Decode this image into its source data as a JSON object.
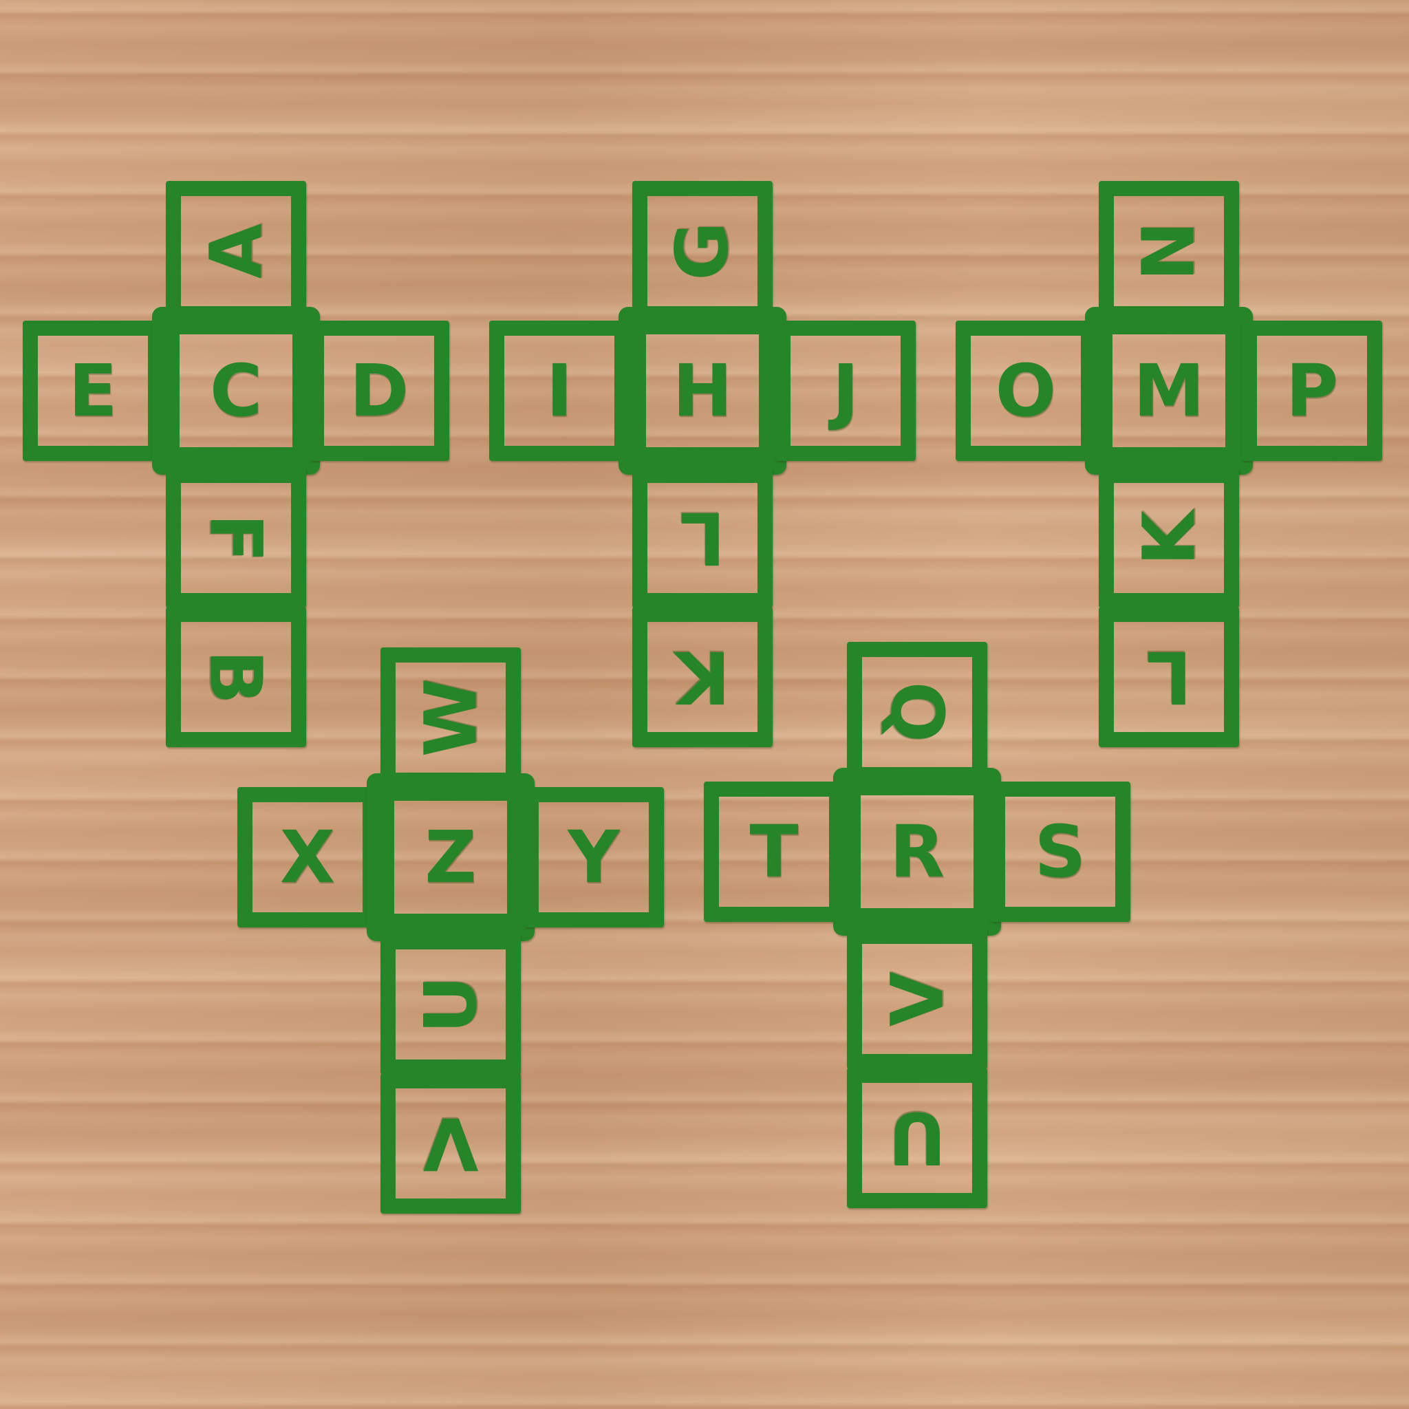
{
  "nets": [
    {
      "center": "C",
      "top": "A",
      "left": "E",
      "right": "D",
      "below": "F",
      "bottom": "B"
    },
    {
      "center": "H",
      "top": "G",
      "left": "I",
      "right": "J",
      "below": "L",
      "bottom": "K"
    },
    {
      "center": "M",
      "top": "N",
      "left": "O",
      "right": "P",
      "below": "K",
      "bottom": "L"
    },
    {
      "center": "Z",
      "top": "W",
      "left": "X",
      "right": "Y",
      "below": "U",
      "bottom": "V"
    },
    {
      "center": "R",
      "top": "Q",
      "left": "T",
      "right": "S",
      "below": "V",
      "bottom": "U"
    }
  ],
  "colors": {
    "piece": "#268528",
    "wood": "#cfa27c"
  }
}
